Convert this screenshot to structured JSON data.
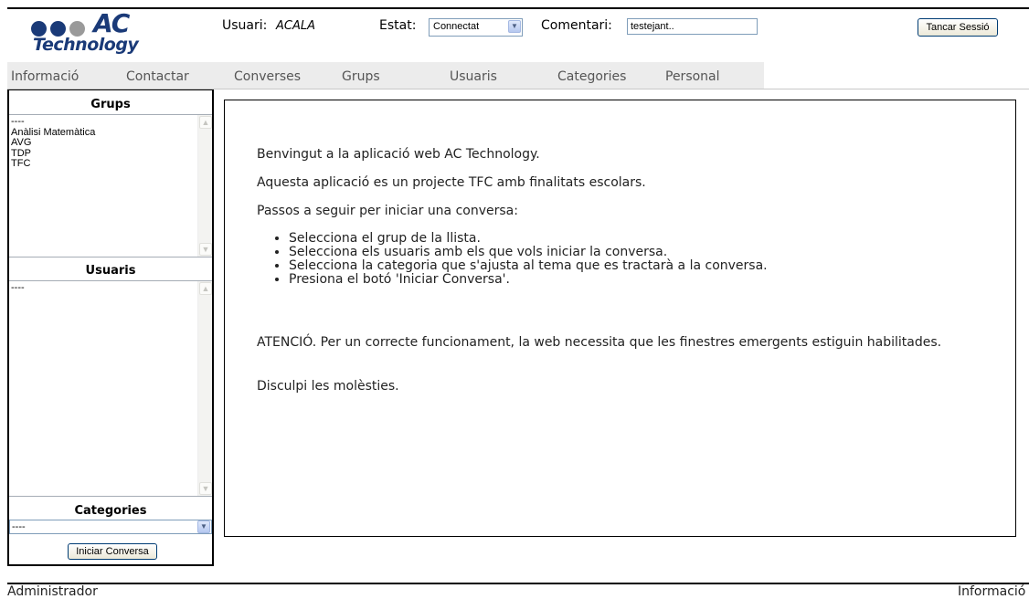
{
  "logo": {
    "title": "AC",
    "subtitle": "Technology",
    "dot_colors": [
      "#1a3a78",
      "#1a3a78",
      "#9a9a9a"
    ]
  },
  "header": {
    "user_label": "Usuari:",
    "user_value": "ACALA",
    "status_label": "Estat:",
    "status_value": "Connectat",
    "comment_label": "Comentari:",
    "comment_value": "testejant..",
    "logout_label": "Tancar Sessió"
  },
  "nav": {
    "items": [
      "Informació",
      "Contactar",
      "Converses",
      "Grups",
      "Usuaris",
      "Categories",
      "Personal"
    ]
  },
  "sidebar": {
    "groups_title": "Grups",
    "groups": [
      "----",
      "Anàlisi Matemàtica",
      "AVG",
      "TDP",
      "TFC"
    ],
    "users_title": "Usuaris",
    "users": [
      "----"
    ],
    "categories_title": "Categories",
    "category_value": "----",
    "start_button": "Iniciar Conversa"
  },
  "content": {
    "welcome": "Benvingut a la aplicació web AC Technology.",
    "intro": "Aquesta aplicació es un projecte TFC amb finalitats escolars.",
    "steps_title": "Passos a seguir per iniciar una conversa:",
    "steps": [
      "Selecciona el grup de la llista.",
      "Selecciona els usuaris amb els que vols iniciar la conversa.",
      "Selecciona la categoria que s'ajusta al tema que es tractarà a la conversa.",
      "Presiona el botó 'Iniciar Conversa'."
    ],
    "warning": "ATENCIÓ. Per un correcte funcionament, la web necessita que les finestres emergents estiguin habilitades.",
    "apology": "Disculpi les molèsties."
  },
  "footer": {
    "left": "Administrador",
    "right": "Informació"
  }
}
